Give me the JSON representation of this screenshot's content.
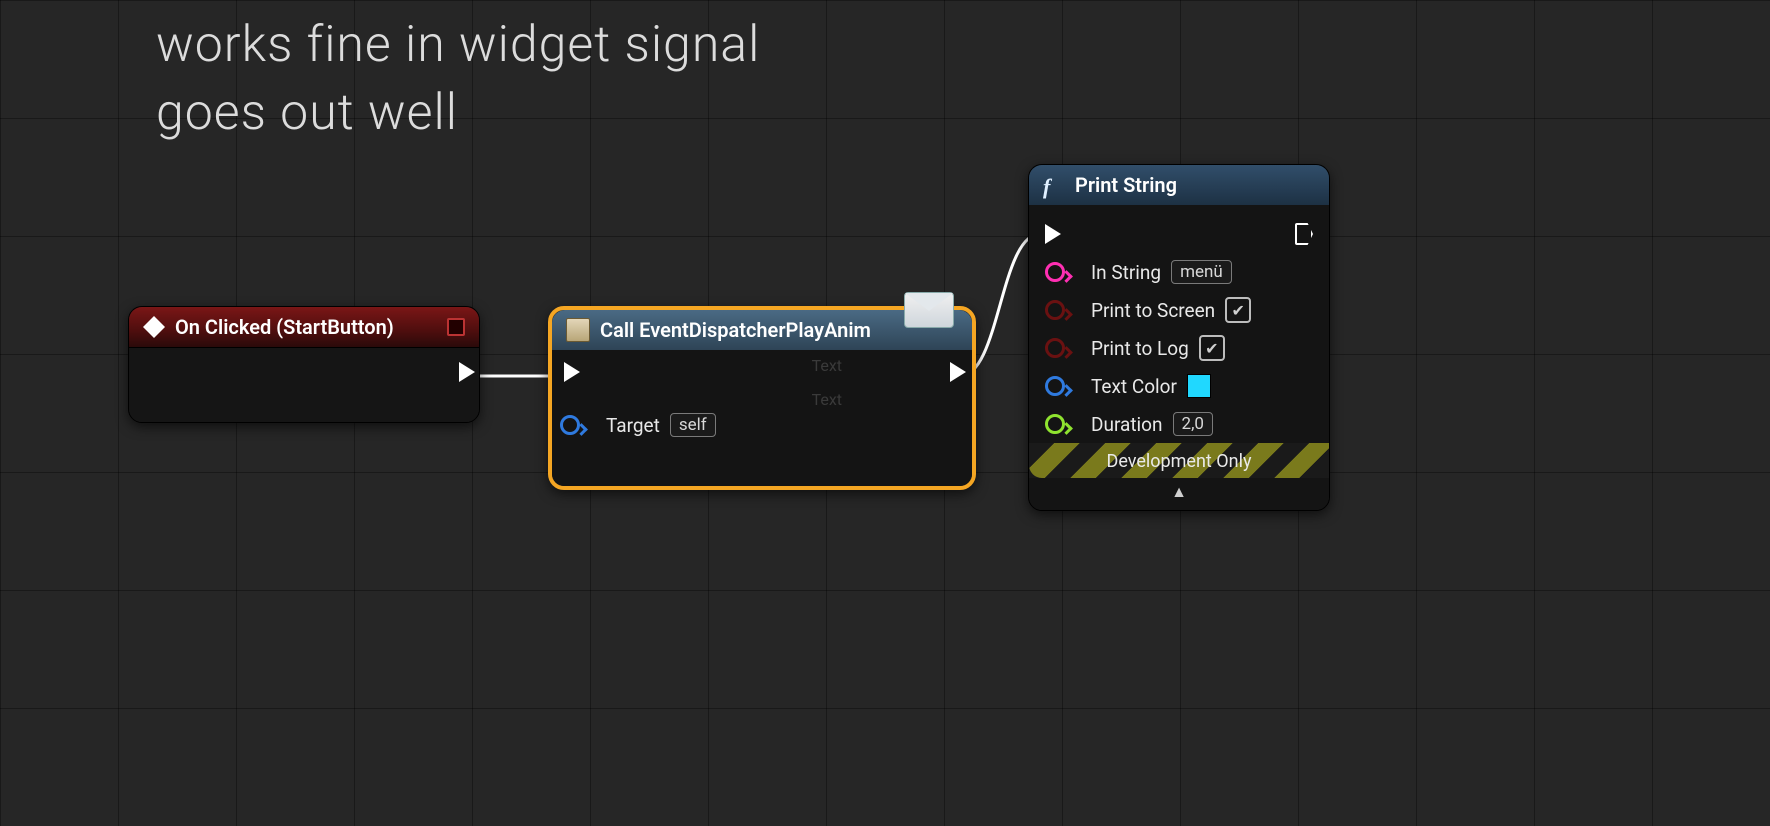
{
  "annotation": {
    "line1": "works fine in widget signal",
    "line2": "goes out well"
  },
  "nodes": {
    "event": {
      "title": "On Clicked (StartButton)"
    },
    "dispatch": {
      "title": "Call EventDispatcherPlayAnim",
      "target_label": "Target",
      "target_value": "self",
      "bg_text1": "Text",
      "bg_text2": "Text"
    },
    "print": {
      "title": "Print String",
      "in_string_label": "In String",
      "in_string_value": "menü",
      "print_screen_label": "Print to Screen",
      "print_log_label": "Print to Log",
      "text_color_label": "Text Color",
      "text_color_value": "#20d8ff",
      "duration_label": "Duration",
      "duration_value": "2,0",
      "dev_only_label": "Development Only"
    }
  }
}
